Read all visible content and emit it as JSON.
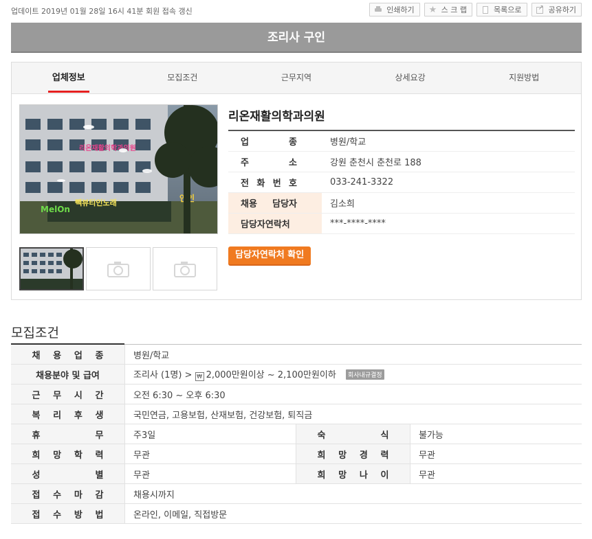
{
  "topbar": {
    "update_text": "업데이트 2019년 01월 28일 16시 41분 회원 접속 갱신",
    "buttons": [
      {
        "label": "인쇄하기",
        "icon": "print-icon"
      },
      {
        "label": "스 크 랩",
        "icon": "star-icon"
      },
      {
        "label": "목록으로",
        "icon": "list-icon"
      },
      {
        "label": "공유하기",
        "icon": "share-icon"
      }
    ]
  },
  "page_title": "조리사 구인",
  "tabs": [
    "업체정보",
    "모집조건",
    "근무지역",
    "상세요강",
    "지원방법"
  ],
  "company": {
    "name": "리온재활의학과의원",
    "info": [
      {
        "label": "업종",
        "value": "병원/학교"
      },
      {
        "label": "주소",
        "value": "강원 춘천시 춘천로 188"
      },
      {
        "label": "전화번호",
        "value": "033-241-3322"
      },
      {
        "label": "채용담당자",
        "value": "김소희"
      },
      {
        "label": "담당자연락처",
        "value": "***-****-****"
      }
    ],
    "contact_button": "담당자연락처 확인"
  },
  "photo_sign": {
    "clinic": "리온재활의학과의원",
    "store": "MelOn",
    "store2": "빽뷰티인노래",
    "store3": "연인"
  },
  "conditions": {
    "title": "모집조건",
    "rows": [
      {
        "label": "채용업종",
        "value": "병원/학교"
      },
      {
        "label": "채용분야 및 급여",
        "value_prefix": "조리사 (1명) >",
        "salary": "2,000만원이상 ~ 2,100만원이하",
        "badge": "회사내규결정"
      },
      {
        "label": "근무시간",
        "value": "오전 6:30 ~ 오후 6:30"
      },
      {
        "label": "복리후생",
        "value": "국민연금, 고용보험, 산재보험, 건강보험, 퇴직금"
      },
      {
        "label": "휴무",
        "value": "주3일",
        "label2": "숙식",
        "value2": "불가능"
      },
      {
        "label": "희망학력",
        "value": "무관",
        "label2": "희망경력",
        "value2": "무관"
      },
      {
        "label": "성별",
        "value": "무관",
        "label2": "희망나이",
        "value2": "무관"
      },
      {
        "label": "접수마감",
        "value": "채용시까지"
      },
      {
        "label": "접수방법",
        "value": "온라인, 이메일, 직접방문"
      }
    ]
  }
}
